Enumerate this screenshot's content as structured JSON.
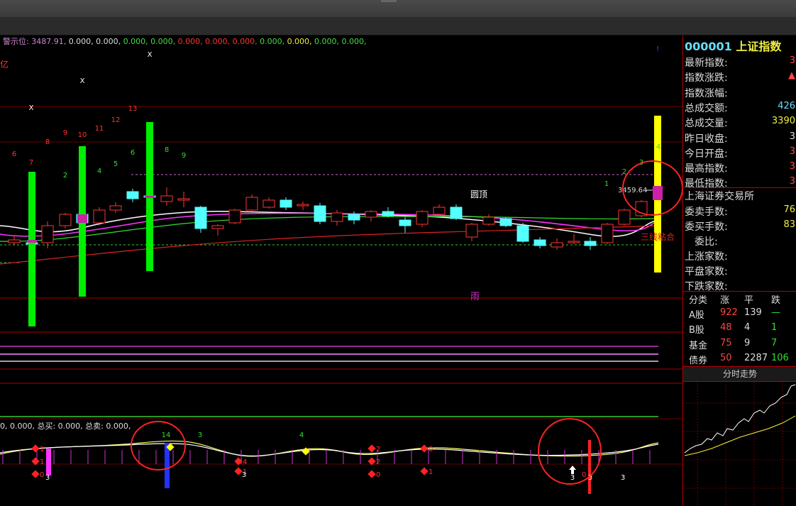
{
  "indicator_main": {
    "label": "警示位:",
    "values": [
      "3487.91,",
      "0.000,",
      "0.000,",
      "0.000,",
      "0.000,",
      "0.000,",
      "0.000,",
      "0.000,",
      "0.000,",
      "0.000,",
      "0.000,",
      "0.000,"
    ],
    "colors": [
      "#c8c",
      "#ddd",
      "#ddd",
      "#4d4",
      "#4d4",
      "#f33",
      "#f33",
      "#f33",
      "#4d4",
      "#ee4",
      "#4d4",
      "#4d4"
    ]
  },
  "unit_label": "亿",
  "chart_text": {
    "pattern_top": "圆顶",
    "pattern_rain": "雨",
    "pattern_triple": "三线粘合",
    "price_tag": "3459.64"
  },
  "counts_red": [
    "6",
    "7",
    "8",
    "9",
    "10",
    "11",
    "12",
    "13"
  ],
  "counts_green": [
    "2",
    "4",
    "5",
    "6",
    "8",
    "9",
    "1",
    "2",
    "3",
    "4"
  ],
  "x_marks": [
    "X",
    "X",
    "X"
  ],
  "bottom_indicator": {
    "text": "0, 0.000, 总买: 0.000, 总卖: 0.000,",
    "labels_top": [
      "14",
      "3",
      "4"
    ],
    "labels_diamond": [
      "1",
      "1",
      "4",
      "1",
      "2",
      "2",
      "0",
      "0",
      "0",
      "1"
    ],
    "labels_bottom": [
      "3",
      "3",
      "3",
      "3",
      "3"
    ],
    "arrow_label": "0"
  },
  "quote": {
    "code": "000001",
    "name": "上证指数",
    "rows": [
      {
        "label": "最新指数:",
        "value": "3",
        "color": "#f44"
      },
      {
        "label": "指数涨跌:",
        "value": "▲",
        "color": "#f44"
      },
      {
        "label": "指数涨幅:",
        "value": "",
        "color": "#f44"
      },
      {
        "label": "总成交额:",
        "value": "426",
        "color": "#6df"
      },
      {
        "label": "总成交量:",
        "value": "3390",
        "color": "#ee4"
      },
      {
        "label": "昨日收盘:",
        "value": "3",
        "color": "#ddd"
      },
      {
        "label": "今日开盘:",
        "value": "3",
        "color": "#f44"
      },
      {
        "label": "最高指数:",
        "value": "3",
        "color": "#f44"
      },
      {
        "label": "最低指数:",
        "value": "3",
        "color": "#f44"
      }
    ],
    "exchange": "上海证券交易所",
    "rows2": [
      {
        "label": "委卖手数:",
        "value": "76",
        "color": "#ee4"
      },
      {
        "label": "委买手数:",
        "value": "83",
        "color": "#ee4"
      },
      {
        "label": "　委比:",
        "value": "",
        "color": "#ddd"
      },
      {
        "label": "上涨家数:",
        "value": "",
        "color": "#ddd"
      },
      {
        "label": "平盘家数:",
        "value": "",
        "color": "#ddd"
      },
      {
        "label": "下跌家数:",
        "value": "",
        "color": "#ddd"
      }
    ]
  },
  "breadth_table": {
    "headers": [
      "分类",
      "涨",
      "平",
      "跌"
    ],
    "rows": [
      {
        "cat": "A股",
        "up": "922",
        "flat": "139",
        "down": "—"
      },
      {
        "cat": "B股",
        "up": "48",
        "flat": "4",
        "down": "1"
      },
      {
        "cat": "基金",
        "up": "75",
        "flat": "9",
        "down": "7"
      },
      {
        "cat": "债券",
        "up": "50",
        "flat": "2287",
        "down": "106"
      }
    ]
  },
  "fenshi_label": "分时走势",
  "colors": {
    "up": "#ff3333",
    "down": "#54ffff",
    "ma_white": "#ffffff",
    "ma_magenta": "#ff33ff",
    "ma_green": "#33dd33",
    "ma_red": "#dd2222",
    "bar_green": "#00ee00",
    "bar_yellow": "#ffff00",
    "grid": "#7a0000"
  }
}
